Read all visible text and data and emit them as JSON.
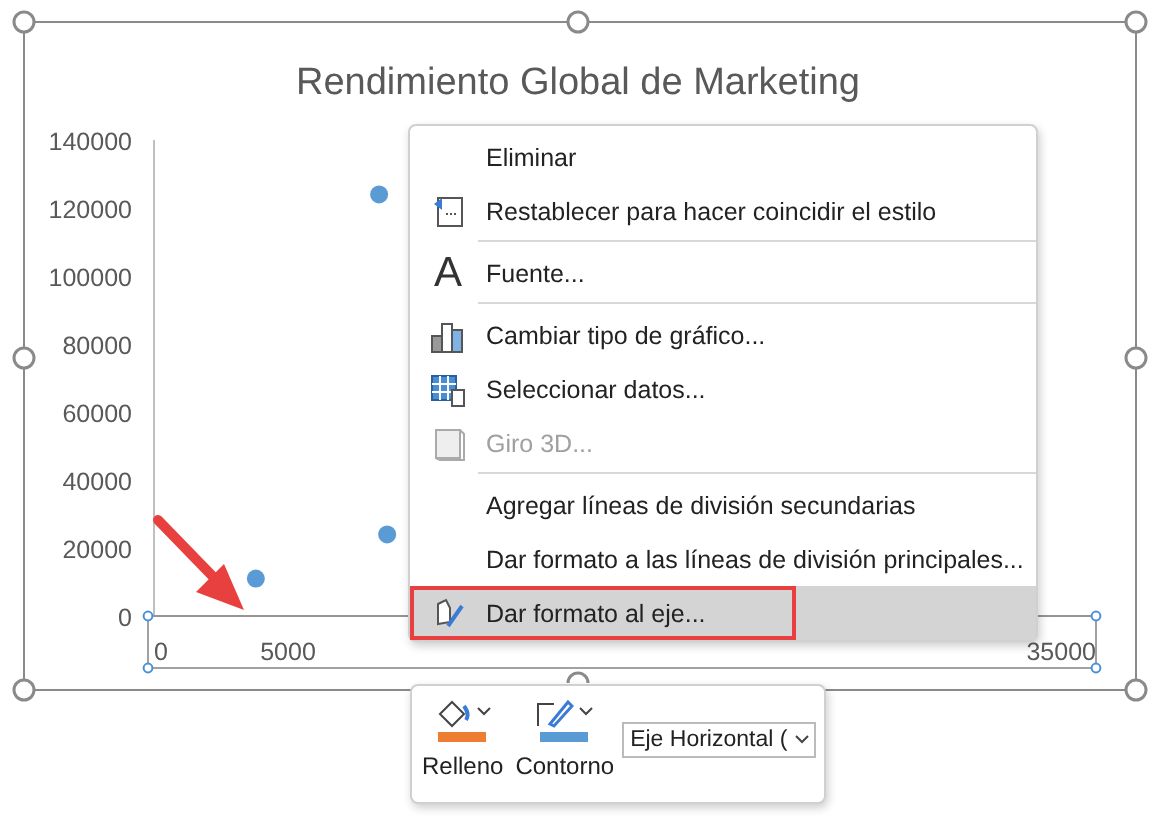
{
  "chart": {
    "selected": true,
    "chart_data": {
      "type": "scatter",
      "title": "Rendimiento Global de Marketing",
      "x": [
        3800,
        8400,
        8700
      ],
      "series": [
        {
          "color": "#5b9bd5",
          "values": [
            11000,
            124000,
            24000
          ]
        }
      ],
      "xlim": [
        0,
        35000
      ],
      "ylim": [
        0,
        140000
      ],
      "xticks": [
        0,
        5000,
        35000
      ],
      "yticks": [
        0,
        20000,
        40000,
        60000,
        80000,
        100000,
        120000,
        140000
      ]
    },
    "x_axis_selected": true
  },
  "context_menu": {
    "items": [
      {
        "label": "Eliminar",
        "kind": "plain",
        "disabled": false,
        "selected": false,
        "separator_before": false
      },
      {
        "label": "Restablecer para hacer coincidir el estilo",
        "kind": "reset",
        "disabled": false,
        "selected": false,
        "separator_before": false
      },
      {
        "label": "Fuente...",
        "kind": "font",
        "glyph": "A",
        "disabled": false,
        "selected": false,
        "separator_before": true
      },
      {
        "label": "Cambiar tipo de gráfico...",
        "kind": "chart",
        "disabled": false,
        "selected": false,
        "separator_before": true
      },
      {
        "label": "Seleccionar datos...",
        "kind": "data",
        "disabled": false,
        "selected": false,
        "separator_before": false
      },
      {
        "label": "Giro 3D...",
        "kind": "rotate",
        "disabled": true,
        "selected": false,
        "separator_before": false
      },
      {
        "label": "Agregar líneas de división secundarias",
        "kind": "plain",
        "disabled": false,
        "selected": false,
        "separator_before": true
      },
      {
        "label": "Dar formato a las líneas de división principales...",
        "kind": "plain",
        "disabled": false,
        "selected": false,
        "separator_before": false
      },
      {
        "label": "Dar formato al eje...",
        "kind": "format",
        "disabled": false,
        "selected": true,
        "separator_before": false,
        "highlighted": true
      }
    ]
  },
  "mini_toolbar": {
    "buttons": [
      {
        "label": "Relleno",
        "kind": "fill",
        "color": "#ed7d31"
      },
      {
        "label": "Contorno",
        "kind": "outline",
        "color": "#5b9bd5"
      }
    ],
    "dropdown": {
      "value": "Eje Horizontal ("
    }
  },
  "annotation_arrow": true
}
